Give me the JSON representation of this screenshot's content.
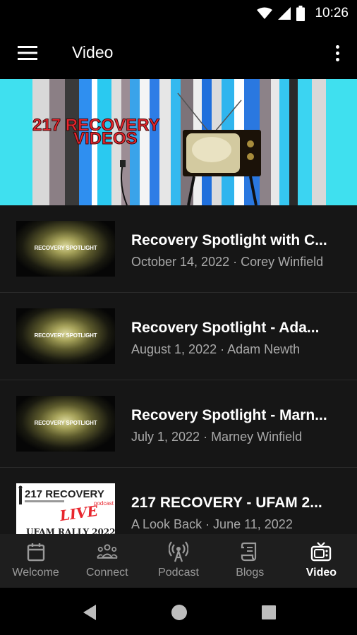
{
  "status_bar": {
    "time": "10:26"
  },
  "app_bar": {
    "title": "Video"
  },
  "hero": {
    "line1": "217 RECOVERY",
    "line2": "VIDEOS"
  },
  "videos": [
    {
      "title": "Recovery Spotlight with C...",
      "subtitle": "October 14, 2022 · Corey Winfield",
      "thumb_text": "RECOVERY SPOTLIGHT"
    },
    {
      "title": "Recovery Spotlight - Ada...",
      "subtitle": "August 1, 2022 · Adam Newth",
      "thumb_text": "RECOVERY SPOTLIGHT"
    },
    {
      "title": "Recovery Spotlight - Marn...",
      "subtitle": "July 1, 2022 · Marney Winfield",
      "thumb_text": "RECOVERY SPOTLIGHT"
    },
    {
      "title": "217 RECOVERY - UFAM 2...",
      "subtitle": "A Look Back · June 11, 2022",
      "thumb_brand": "217 RECOVERY",
      "thumb_small": "podcast",
      "thumb_live": "LIVE",
      "thumb_caption": "UFAM RALLY 2022"
    }
  ],
  "bottom_nav": [
    {
      "label": "Welcome",
      "icon": "calendar-icon"
    },
    {
      "label": "Connect",
      "icon": "people-icon"
    },
    {
      "label": "Podcast",
      "icon": "podcast-icon"
    },
    {
      "label": "Blogs",
      "icon": "scroll-icon"
    },
    {
      "label": "Video",
      "icon": "tv-icon",
      "active": true
    }
  ],
  "colors": {
    "accent_red": "#e8262e",
    "stripe_cyan": "#34d3f2",
    "stripe_blue": "#1e7fe0"
  }
}
